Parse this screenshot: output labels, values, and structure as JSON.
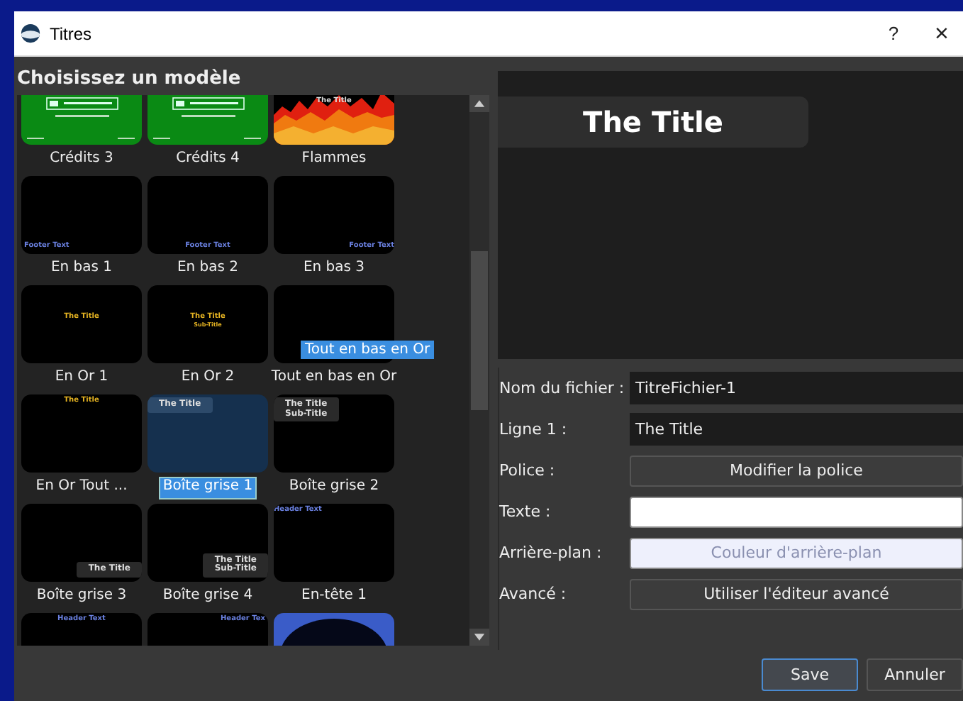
{
  "window": {
    "title": "Titres",
    "help": "?",
    "close": "×"
  },
  "heading": "Choisissez un modèle",
  "templates": [
    {
      "caption": "Crédits 3",
      "selected": false,
      "thumb": {
        "kind": "credits"
      }
    },
    {
      "caption": "Crédits 4",
      "selected": false,
      "thumb": {
        "kind": "credits"
      }
    },
    {
      "caption": "Flammes",
      "selected": false,
      "thumb": {
        "kind": "flames",
        "texts": [
          "The Title"
        ]
      }
    },
    {
      "caption": "En bas 1",
      "selected": false,
      "thumb": {
        "kind": "footer-left",
        "texts": [
          "Footer Text"
        ]
      }
    },
    {
      "caption": "En bas 2",
      "selected": false,
      "thumb": {
        "kind": "footer-center",
        "texts": [
          "Footer Text"
        ]
      }
    },
    {
      "caption": "En bas 3",
      "selected": false,
      "thumb": {
        "kind": "footer-right",
        "texts": [
          "Footer Text"
        ]
      }
    },
    {
      "caption": "En Or 1",
      "selected": false,
      "thumb": {
        "kind": "gold-center",
        "texts": [
          "The Title"
        ]
      }
    },
    {
      "caption": "En Or 2",
      "selected": false,
      "thumb": {
        "kind": "gold-center",
        "texts": [
          "The Title",
          "Sub-Title"
        ]
      }
    },
    {
      "caption": "Tout en bas en Or",
      "selected": false,
      "thumb": {
        "kind": "blank"
      }
    },
    {
      "caption": "En Or Tout ...",
      "selected": false,
      "thumb": {
        "kind": "gold-top",
        "texts": [
          "The Title"
        ]
      }
    },
    {
      "caption": "Boîte grise 1",
      "selected": true,
      "thumb": {
        "kind": "box-top",
        "texts": [
          "The Title"
        ]
      }
    },
    {
      "caption": "Boîte grise 2",
      "selected": false,
      "thumb": {
        "kind": "box-top",
        "texts": [
          "The Title",
          "Sub-Title"
        ]
      }
    },
    {
      "caption": "Boîte grise 3",
      "selected": false,
      "thumb": {
        "kind": "box-bottom",
        "texts": [
          "The Title"
        ]
      }
    },
    {
      "caption": "Boîte grise 4",
      "selected": false,
      "thumb": {
        "kind": "box-bottom",
        "texts": [
          "The Title",
          "Sub-Title"
        ]
      }
    },
    {
      "caption": "En-tête 1",
      "selected": false,
      "thumb": {
        "kind": "header-left",
        "texts": [
          "Header Text"
        ]
      }
    },
    {
      "selected": false,
      "thumb": {
        "kind": "header-center",
        "texts": [
          "Header Text"
        ]
      }
    },
    {
      "selected": false,
      "thumb": {
        "kind": "header-right",
        "texts": [
          "Header Tex"
        ]
      }
    },
    {
      "selected": false,
      "thumb": {
        "kind": "oval"
      }
    }
  ],
  "tooltip": "Tout en bas en Or",
  "preview": {
    "title": "The Title"
  },
  "form": [
    {
      "label": "Nom du fichier :",
      "kind": "input",
      "value": "TitreFichier-1"
    },
    {
      "label": "Ligne 1 :",
      "kind": "input",
      "value": "The Title"
    },
    {
      "label": "Police :",
      "kind": "button",
      "value": "Modifier la police"
    },
    {
      "label": "Texte :",
      "kind": "color",
      "color": "#ffffff"
    },
    {
      "label": "Arrière-plan :",
      "kind": "color",
      "color": "#eef0fc",
      "value": "Couleur d'arrière-plan"
    },
    {
      "label": "Avancé :",
      "kind": "button",
      "value": "Utiliser l'éditeur avancé"
    }
  ],
  "buttons": [
    {
      "label": "Save",
      "default": true
    },
    {
      "label": "Annuler",
      "default": false
    }
  ]
}
